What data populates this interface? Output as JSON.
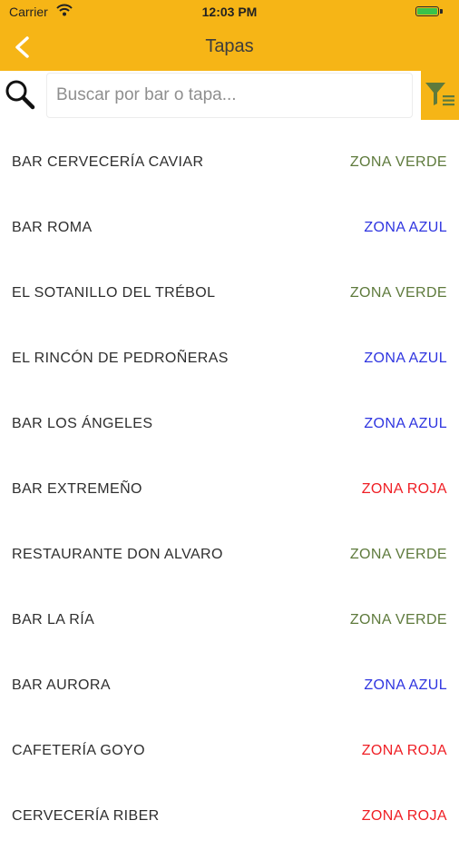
{
  "status_bar": {
    "carrier": "Carrier",
    "time": "12:03 PM"
  },
  "nav": {
    "title": "Tapas"
  },
  "search": {
    "placeholder": "Buscar por bar o tapa..."
  },
  "zone_colors": {
    "ZONA VERDE": "#5e7a3c",
    "ZONA AZUL": "#2f35e0",
    "ZONA ROJA": "#ef1e24"
  },
  "bars": [
    {
      "name": "BAR CERVECERÍA CAVIAR",
      "zone": "ZONA VERDE"
    },
    {
      "name": "BAR ROMA",
      "zone": "ZONA AZUL"
    },
    {
      "name": "EL SOTANILLO DEL TRÉBOL",
      "zone": "ZONA VERDE"
    },
    {
      "name": "EL RINCÓN DE PEDROÑERAS",
      "zone": "ZONA AZUL"
    },
    {
      "name": "BAR LOS ÁNGELES",
      "zone": "ZONA AZUL"
    },
    {
      "name": "BAR EXTREMEÑO",
      "zone": "ZONA ROJA"
    },
    {
      "name": "RESTAURANTE DON ALVARO",
      "zone": "ZONA VERDE"
    },
    {
      "name": "BAR LA RÍA",
      "zone": "ZONA VERDE"
    },
    {
      "name": "BAR AURORA",
      "zone": "ZONA AZUL"
    },
    {
      "name": "CAFETERÍA GOYO",
      "zone": "ZONA ROJA"
    },
    {
      "name": "CERVECERÍA RIBER",
      "zone": "ZONA ROJA"
    }
  ]
}
